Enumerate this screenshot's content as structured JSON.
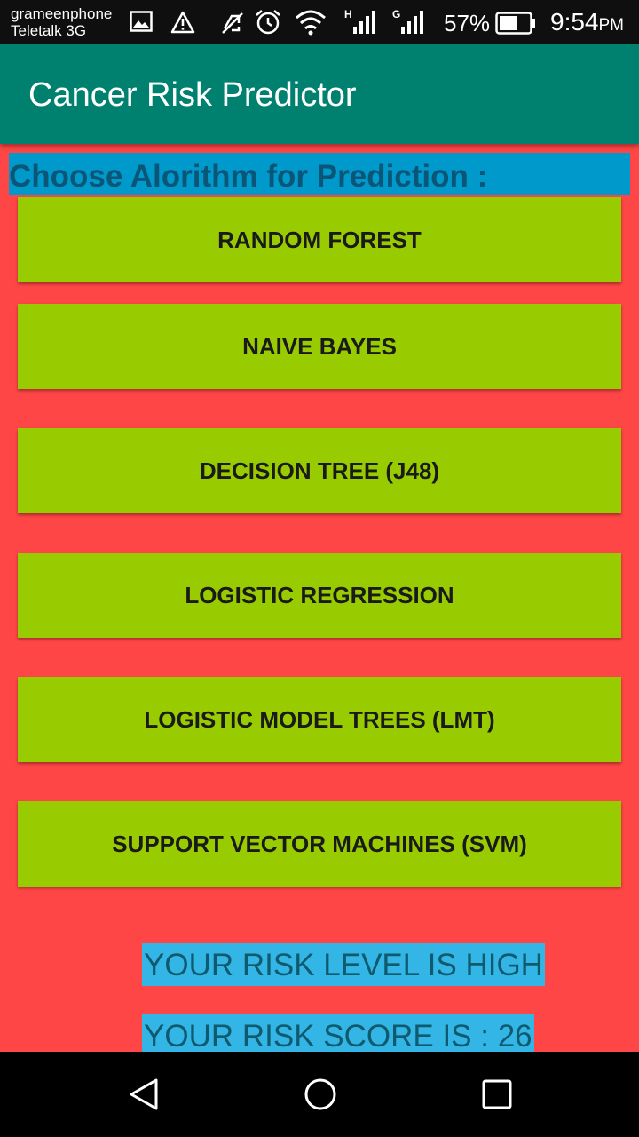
{
  "status_bar": {
    "carrier_1": "grameenphone",
    "carrier_2": "Teletalk 3G",
    "signal_1_type": "H",
    "signal_2_type": "G",
    "battery_percent": "57%",
    "time": "9:54",
    "ampm": "PM",
    "icons": [
      "image-icon",
      "warning-icon",
      "vibrate-off-icon",
      "alarm-icon",
      "wifi-icon",
      "signal-icon",
      "signal-icon",
      "battery-icon"
    ]
  },
  "app_bar": {
    "title": "Cancer Risk Predictor"
  },
  "main": {
    "heading": "Choose Alorithm for Prediction :",
    "buttons": [
      "RANDOM FOREST",
      "NAIVE BAYES",
      "DECISION TREE (J48)",
      "LOGISTIC REGRESSION",
      "LOGISTIC MODEL TREES (LMT)",
      "SUPPORT VECTOR MACHINES (SVM)"
    ],
    "risk_level": "YOUR RISK LEVEL IS HIGH",
    "risk_score": "YOUR RISK SCORE IS : 26"
  },
  "nav_bar": {
    "icons": [
      "back-icon",
      "home-icon",
      "recents-icon"
    ]
  },
  "colors": {
    "app_bar": "#00806f",
    "content_bg": "#ff4646",
    "heading_bg": "#0099cc",
    "button_bg": "#99cc00",
    "result_bg": "#33b5e5"
  }
}
